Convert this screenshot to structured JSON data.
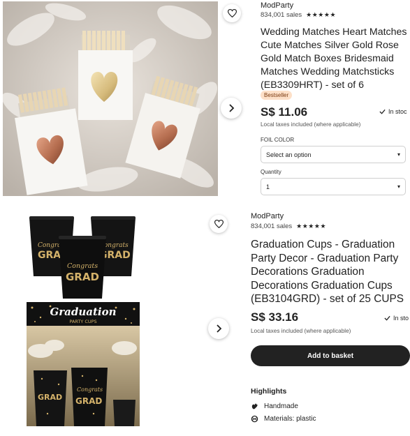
{
  "listing_1": {
    "shop_name": "ModParty",
    "sales": "834,001 sales",
    "stars": "★★★★★",
    "title": "Wedding Matches Heart Matches Cute Matches Silver Gold Rose Gold Match Boxes Bridesmaid Matches Wedding Matchsticks (EB3309HRT) - set of 6",
    "badge": "Bestseller",
    "price": "S$ 11.06",
    "stock": "In stoc",
    "tax_note": "Local taxes included (where applicable)",
    "foil_label": "FOIL COLOR",
    "foil_value": "Select an option",
    "quantity_label": "Quantity",
    "quantity_value": "1",
    "caret": "▾"
  },
  "listing_2": {
    "shop_name": "ModParty",
    "sales": "834,001 sales",
    "stars": "★★★★★",
    "title": "Graduation Cups - Graduation Party Decor - Graduation Party Decorations Graduation Decorations Graduation Cups (EB3104GRD) - set of 25 CUPS",
    "price": "S$ 33.16",
    "stock": "In sto",
    "tax_note": "Local taxes included (where applicable)",
    "basket_label": "Add to basket",
    "highlights_title": "Highlights",
    "highlights": [
      {
        "icon": "hand-icon",
        "label": "Handmade"
      },
      {
        "icon": "materials-icon",
        "label": "Materials: plastic"
      }
    ],
    "cup_text_1": "Congrats",
    "cup_text_2": "GRAD",
    "banner_title": "Graduation",
    "banner_sub": "PARTY CUPS"
  },
  "colors": {
    "text": "#222222",
    "button_dark": "#222222",
    "badge_bg": "#fde0c8",
    "cup_black": "#141414",
    "gold": "#d4b26a",
    "rose_gold": "#c88a6a"
  }
}
